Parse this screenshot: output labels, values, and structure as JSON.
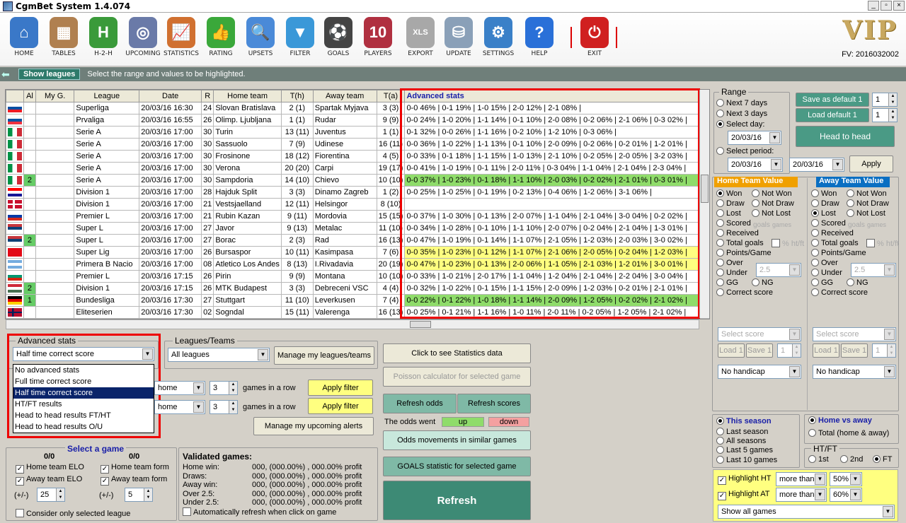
{
  "window": {
    "title": "CgmBet System  1.4.074"
  },
  "toolbar": {
    "items": [
      {
        "name": "home",
        "label": "HOME",
        "icon": "house-icon",
        "color": "#3a78c8",
        "glyph": "⌂"
      },
      {
        "name": "tables",
        "label": "TABLES",
        "icon": "table-icon",
        "color": "#b08050",
        "glyph": "▦"
      },
      {
        "name": "h2h",
        "label": "H-2-H",
        "icon": "h2h-icon",
        "color": "#3a9a3a",
        "glyph": "H"
      },
      {
        "name": "upcoming",
        "label": "UPCOMING",
        "icon": "stadium-icon",
        "color": "#6a7aa8",
        "glyph": "◎"
      },
      {
        "name": "statistics",
        "label": "STATISTICS",
        "icon": "chart-icon",
        "color": "#d07030",
        "glyph": "📈"
      },
      {
        "name": "rating",
        "label": "RATING",
        "icon": "thumb-icon",
        "color": "#3aa83a",
        "glyph": "👍"
      },
      {
        "name": "upsets",
        "label": "UPSETS",
        "icon": "magnifier-icon",
        "color": "#4a8ad8",
        "glyph": "🔍"
      },
      {
        "name": "filter",
        "label": "FILTER",
        "icon": "funnel-icon",
        "color": "#3a98d8",
        "glyph": "▼"
      },
      {
        "name": "goals",
        "label": "GOALS",
        "icon": "ball-icon",
        "color": "#444444",
        "glyph": "⚽"
      },
      {
        "name": "players",
        "label": "PLAYERS",
        "icon": "shirt-icon",
        "color": "#b03040",
        "glyph": "10"
      },
      {
        "name": "export",
        "label": "EXPORT",
        "icon": "excel-icon",
        "color": "#a8a8a8",
        "glyph": "XLS"
      },
      {
        "name": "update",
        "label": "UPDATE",
        "icon": "database-icon",
        "color": "#8aa0b8",
        "glyph": "⛁"
      },
      {
        "name": "settings",
        "label": "SETTINGS",
        "icon": "gears-icon",
        "color": "#3a80c8",
        "glyph": "⚙"
      },
      {
        "name": "help",
        "label": "HELP",
        "icon": "question-icon",
        "color": "#2a70d8",
        "glyph": "?"
      },
      {
        "name": "exit",
        "label": "EXIT",
        "icon": "power-icon",
        "color": "#d02020",
        "glyph": "⏻"
      }
    ],
    "brand": "VIP",
    "fv": "FV: 2016032002"
  },
  "infobar": {
    "tab": "Show leagues",
    "hint": "Select the range and values to be highlighted."
  },
  "grid": {
    "columns": [
      "",
      "Al",
      "My G.",
      "League",
      "Date",
      "R",
      "Home team",
      "T(h)",
      "Away team",
      "T(a)",
      "Advanced stats"
    ],
    "rows": [
      {
        "flag": "svk",
        "al": "",
        "league": "Superliga",
        "date": "20/03/16 16:30",
        "r": "24",
        "home": "Slovan Bratislava",
        "th": "2 (1)",
        "away": "Spartak Myjava",
        "ta": "3 (3)",
        "adv": "0-0 46% | 0-1 19% | 1-0 15% | 2-0 12% | 2-1 08% |",
        "hl": ""
      },
      {
        "flag": "svn",
        "al": "",
        "league": "Prvaliga",
        "date": "20/03/16 16:55",
        "r": "26",
        "home": "Olimp. Ljubljana",
        "th": "1 (1)",
        "away": "Rudar",
        "ta": "9 (9)",
        "adv": "0-0 24% | 1-0 20% | 1-1 14% | 0-1 10% | 2-0 08% | 0-2 06% | 2-1 06% | 0-3 02% |",
        "hl": ""
      },
      {
        "flag": "ita",
        "al": "",
        "league": "Serie A",
        "date": "20/03/16 17:00",
        "r": "30",
        "home": "Turin",
        "th": "13 (11)",
        "away": "Juventus",
        "ta": "1 (1)",
        "adv": "0-1 32% | 0-0 26% | 1-1 16% | 0-2 10% | 1-2 10% | 0-3 06% |",
        "hl": ""
      },
      {
        "flag": "ita",
        "al": "",
        "league": "Serie A",
        "date": "20/03/16 17:00",
        "r": "30",
        "home": "Sassuolo",
        "th": "7 (9)",
        "away": "Udinese",
        "ta": "16 (11)",
        "adv": "0-0 36% | 1-0 22% | 1-1 13% | 0-1 10% | 2-0 09% | 0-2 06% | 0-2 01% | 1-2 01% |",
        "hl": ""
      },
      {
        "flag": "ita",
        "al": "",
        "league": "Serie A",
        "date": "20/03/16 17:00",
        "r": "30",
        "home": "Frosinone",
        "th": "18 (12)",
        "away": "Fiorentina",
        "ta": "4 (5)",
        "adv": "0-0 33% | 0-1 18% | 1-1 15% | 1-0 13% | 2-1 10% | 0-2 05% | 2-0 05% | 3-2 03% |",
        "hl": ""
      },
      {
        "flag": "ita",
        "al": "",
        "league": "Serie A",
        "date": "20/03/16 17:00",
        "r": "30",
        "home": "Verona",
        "th": "20 (20)",
        "away": "Carpi",
        "ta": "19 (17)",
        "adv": "0-0 41% | 1-0 19% | 0-1 11% | 2-0 11% | 0-3 04% | 1-1 04% | 2-1 04% | 2-3 04% |",
        "hl": ""
      },
      {
        "flag": "ita",
        "al": "2",
        "league": "Serie A",
        "date": "20/03/16 17:00",
        "r": "30",
        "home": "Sampdoria",
        "th": "14 (10)",
        "away": "Chievo",
        "ta": "10 (10)",
        "adv": "0-0 37% | 1-0 23% | 0-1 18% | 1-1 10% | 2-0 03% | 0-2 02% | 2-1 01% | 0-3 01% |",
        "hl": "green"
      },
      {
        "flag": "hrv",
        "al": "",
        "league": "Division 1",
        "date": "20/03/16 17:00",
        "r": "28",
        "home": "Hajduk Split",
        "th": "3 (3)",
        "away": "Dinamo Zagreb",
        "ta": "1 (2)",
        "adv": "0-0 25% | 1-0 25% | 0-1 19% | 0-2 13% | 0-4 06% | 1-2 06% | 3-1 06% |",
        "hl": ""
      },
      {
        "flag": "dnk",
        "al": "",
        "league": "Division 1",
        "date": "20/03/16 17:00",
        "r": "21",
        "home": "Vestsjaelland",
        "th": "12 (11)",
        "away": "Helsingor",
        "ta": "8 (10)",
        "adv": "",
        "hl": ""
      },
      {
        "flag": "rus",
        "al": "",
        "league": "Premier L",
        "date": "20/03/16 17:00",
        "r": "21",
        "home": "Rubin Kazan",
        "th": "9 (11)",
        "away": "Mordovia",
        "ta": "15 (15)",
        "adv": "0-0 37% | 1-0 30% | 0-1 13% | 2-0 07% | 1-1 04% | 2-1 04% | 3-0 04% | 0-2 02% |",
        "hl": ""
      },
      {
        "flag": "srb",
        "al": "",
        "league": "Super L",
        "date": "20/03/16 17:00",
        "r": "27",
        "home": "Javor",
        "th": "9 (13)",
        "away": "Metalac",
        "ta": "11 (10)",
        "adv": "0-0 34% | 1-0 28% | 0-1 10% | 1-1 10% | 2-0 07% | 0-2 04% | 2-1 04% | 1-3 01% |",
        "hl": ""
      },
      {
        "flag": "srb",
        "al": "2",
        "league": "Super L",
        "date": "20/03/16 17:00",
        "r": "27",
        "home": "Borac",
        "th": "2 (3)",
        "away": "Rad",
        "ta": "16 (13)",
        "adv": "0-0 47% | 1-0 19% | 0-1 14% | 1-1 07% | 2-1 05% | 1-2 03% | 2-0 03% | 3-0 02% |",
        "hl": ""
      },
      {
        "flag": "tur",
        "al": "",
        "league": "Super Lig",
        "date": "20/03/16 17:00",
        "r": "26",
        "home": "Bursaspor",
        "th": "10 (11)",
        "away": "Kasimpasa",
        "ta": "7 (6)",
        "adv": "0-0 35% | 1-0 23% | 0-1 12% | 1-1 07% | 2-1 06% | 2-0 05% | 0-2 04% | 1-2 03% |",
        "hl": "yellow"
      },
      {
        "flag": "arg",
        "al": "",
        "league": "Primera B Nacio",
        "date": "20/03/16 17:00",
        "r": "08",
        "home": "Atletico Los Andes",
        "th": "8 (13)",
        "away": "I.Rivadavia",
        "ta": "20 (19)",
        "adv": "0-0 47% | 1-0 23% | 0-1 13% | 2-0 06% | 1-1 05% | 2-1 03% | 1-2 01% | 3-0 01% |",
        "hl": "yellow"
      },
      {
        "flag": "bgr",
        "al": "",
        "league": "Premier L",
        "date": "20/03/16 17:15",
        "r": "26",
        "home": "Pirin",
        "th": "9 (9)",
        "away": "Montana",
        "ta": "10 (10)",
        "adv": "0-0 33% | 1-0 21% | 2-0 17% | 1-1 04% | 1-2 04% | 2-1 04% | 2-2 04% | 3-0 04% |",
        "hl": ""
      },
      {
        "flag": "hun",
        "al": "2",
        "league": "Division 1",
        "date": "20/03/16 17:15",
        "r": "26",
        "home": "MTK Budapest",
        "th": "3 (3)",
        "away": "Debreceni VSC",
        "ta": "4 (4)",
        "adv": "0-0 32% | 1-0 22% | 0-1 15% | 1-1 15% | 2-0 09% | 1-2 03% | 0-2 01% | 2-1 01% |",
        "hl": ""
      },
      {
        "flag": "deu",
        "al": "1",
        "league": "Bundesliga",
        "date": "20/03/16 17:30",
        "r": "27",
        "home": "Stuttgart",
        "th": "11 (10)",
        "away": "Leverkusen",
        "ta": "7 (4)",
        "adv": "0-0 22% | 0-1 22% | 1-0 18% | 1-1 14% | 2-0 09% | 1-2 05% | 0-2 02% | 2-1 02% |",
        "hl": "green"
      },
      {
        "flag": "nor",
        "al": "",
        "league": "Eliteserien",
        "date": "20/03/16 17:30",
        "r": "02",
        "home": "Sogndal",
        "th": "15 (11)",
        "away": "Valerenga",
        "ta": "16 (13)",
        "adv": "0-0 25% | 0-1 21% | 1-1 16% | 1-0 11% | 2-0 11% | 0-2 05% | 1-2 05% | 2-1 02% |",
        "hl": ""
      }
    ]
  },
  "advanced": {
    "label": "Advanced stats",
    "value": "Half time correct score",
    "options": [
      "No advanced stats",
      "Full time correct score",
      "Half time correct score",
      "HT/FT results",
      "Head to head results FT/HT",
      "Head to head results O/U"
    ]
  },
  "leagues": {
    "label": "Leagues/Teams",
    "value": "All leagues",
    "manage": "Manage my leagues/teams"
  },
  "alerts": {
    "sel1": "home",
    "sel2": "home",
    "n1": "3",
    "n2": "3",
    "gir": "games in a row",
    "apply": "Apply filter",
    "manage": "Manage my upcoming alerts"
  },
  "center": {
    "stats": "Click to see Statistics data",
    "poisson": "Poisson calculator for selected game",
    "refresh_odds": "Refresh odds",
    "refresh_scores": "Refresh scores",
    "odds_went": "The odds went",
    "up": "up",
    "down": "down",
    "similar": "Odds movements in similar games",
    "goals": "GOALS statistic for selected game",
    "refresh": "Refresh"
  },
  "select_game": {
    "title": "Select a game",
    "l0": "0/0",
    "r0": "0/0",
    "home_elo": "Home team ELO",
    "home_form": "Home team form",
    "away_elo": "Away team ELO",
    "away_form": "Away team form",
    "pm": "(+/-)",
    "v1": "25",
    "v2": "5",
    "consider": "Consider only selected league"
  },
  "validated": {
    "title": "Validated games:",
    "rows": [
      [
        "Home win:",
        "000, (000.00%) , 000.00% profit"
      ],
      [
        "Draws:",
        "000, (000.00%) , 000.00% profit"
      ],
      [
        "Away win:",
        "000, (000.00%) , 000.00% profit"
      ],
      [
        "Over 2.5:",
        "000, (000.00%) , 000.00% profit"
      ],
      [
        "Under 2.5:",
        "000, (000.00%) , 000.00% profit"
      ]
    ],
    "auto": "Automatically refresh when click on game"
  },
  "range": {
    "label": "Range",
    "next7": "Next 7 days",
    "next3": "Next 3 days",
    "selday": "Select day:",
    "day": "20/03/16",
    "selperiod": "Select period:",
    "from": "20/03/16",
    "to": "20/03/16",
    "apply": "Apply",
    "save": "Save as default 1",
    "load": "Load default 1",
    "s1": "1",
    "s2": "1",
    "h2h": "Head to head"
  },
  "home_val": {
    "title": "Home Team Value",
    "won": "Won",
    "notwon": "Not Won",
    "draw": "Draw",
    "notdraw": "Not Draw",
    "lost": "Lost",
    "notlost": "Not Lost",
    "scored": "Scored",
    "goals": "goals",
    "games": "games",
    "received": "Received",
    "total": "Total goals",
    "pct": "% ht/ft",
    "ppg": "Points/Game",
    "over": "Over",
    "under": "Under",
    "ou": "2.5",
    "gg": "GG",
    "ng": "NG",
    "cs": "Correct score",
    "selscore": "Select score",
    "load": "Load 1",
    "save": "Save 1",
    "one": "1",
    "hcp": "No handicap"
  },
  "away_val": {
    "title": "Away Team Value",
    "won": "Won",
    "notwon": "Not Won",
    "draw": "Draw",
    "notdraw": "Not Draw",
    "lost": "Lost",
    "notlost": "Not Lost",
    "scored": "Scored",
    "goals": "goals",
    "games": "games",
    "received": "Received",
    "total": "Total goals",
    "pct": "% ht/ft",
    "ppg": "Points/Game",
    "over": "Over",
    "under": "Under",
    "ou": "2.5",
    "gg": "GG",
    "ng": "NG",
    "cs": "Correct score",
    "selscore": "Select score",
    "load": "Load 1",
    "save": "Save 1",
    "one": "1",
    "hcp": "No handicap"
  },
  "season": {
    "this": "This season",
    "last": "Last season",
    "all": "All seasons",
    "l5": "Last 5 games",
    "l10": "Last 10 games",
    "hva": "Home vs away",
    "total": "Total (home & away)",
    "htft": "HT/FT",
    "first": "1st",
    "second": "2nd",
    "ft": "FT"
  },
  "highlight": {
    "ht": "Highlight HT",
    "at": "Highlight AT",
    "more": "more than",
    "p1": "50%",
    "p2": "60%",
    "show": "Show all games"
  }
}
